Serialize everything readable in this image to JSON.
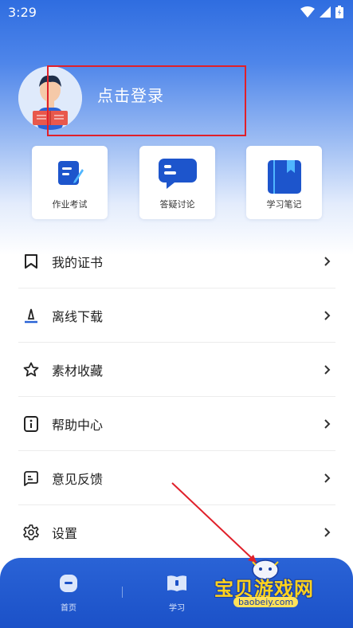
{
  "status_bar": {
    "time": "3:29"
  },
  "profile": {
    "login_label": "点击登录"
  },
  "quick_actions": [
    {
      "label": "作业考试",
      "icon": "pencil-note-icon"
    },
    {
      "label": "答疑讨论",
      "icon": "chat-bubble-icon"
    },
    {
      "label": "学习笔记",
      "icon": "notebook-icon"
    }
  ],
  "menu": [
    {
      "label": "我的证书",
      "icon": "bookmark-icon"
    },
    {
      "label": "离线下载",
      "icon": "download-icon"
    },
    {
      "label": "素材收藏",
      "icon": "star-icon"
    },
    {
      "label": "帮助中心",
      "icon": "info-icon"
    },
    {
      "label": "意见反馈",
      "icon": "feedback-icon"
    },
    {
      "label": "设置",
      "icon": "gear-icon"
    }
  ],
  "bottom_nav": [
    {
      "label": "首页",
      "icon": "home-icon"
    },
    {
      "label": "学习",
      "icon": "book-icon"
    }
  ],
  "watermark": {
    "title": "宝贝游戏网",
    "url": "baobeiy.com"
  },
  "colors": {
    "accent": "#2a63d6",
    "annotation": "#e0202a"
  }
}
